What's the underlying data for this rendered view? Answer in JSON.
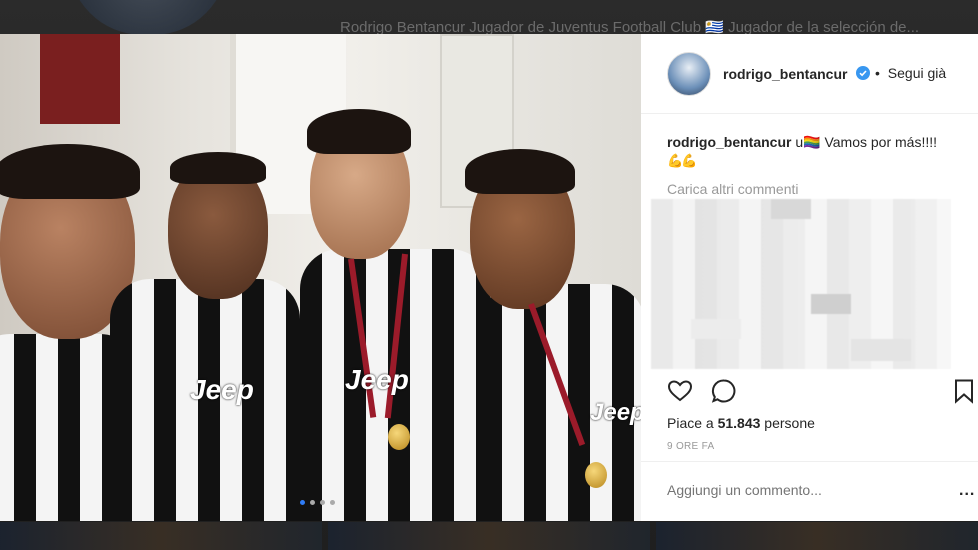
{
  "background": {
    "bio_text": "Rodrigo Bentancur Jugador de Juventus Football Club 🇺🇾 Jugador de la selección de..."
  },
  "photo": {
    "sponsor_text": "Jeep",
    "carousel_dots": 4,
    "active_dot": 1
  },
  "header": {
    "username": "rodrigo_bentancur",
    "follow_separator": "•",
    "follow_label": "Segui già"
  },
  "caption": {
    "username": "rodrigo_bentancur",
    "text": "u🏳️‍🌈 Vamos por más!!!!",
    "line2": "💪💪"
  },
  "comments": {
    "load_more": "Carica altri commenti"
  },
  "actions": {
    "likes_prefix": "Piace a ",
    "likes_count": "51.843",
    "likes_suffix": " persone",
    "time_ago": "9 ORE FA",
    "comment_placeholder": "Aggiungi un commento...",
    "more_label": "..."
  },
  "icons": [
    "heart-icon",
    "comment-icon",
    "bookmark-icon",
    "verified-badge-icon",
    "user-tag-icon"
  ],
  "colors": {
    "verified": "#3897f0",
    "text": "#262626",
    "muted": "#999999"
  }
}
